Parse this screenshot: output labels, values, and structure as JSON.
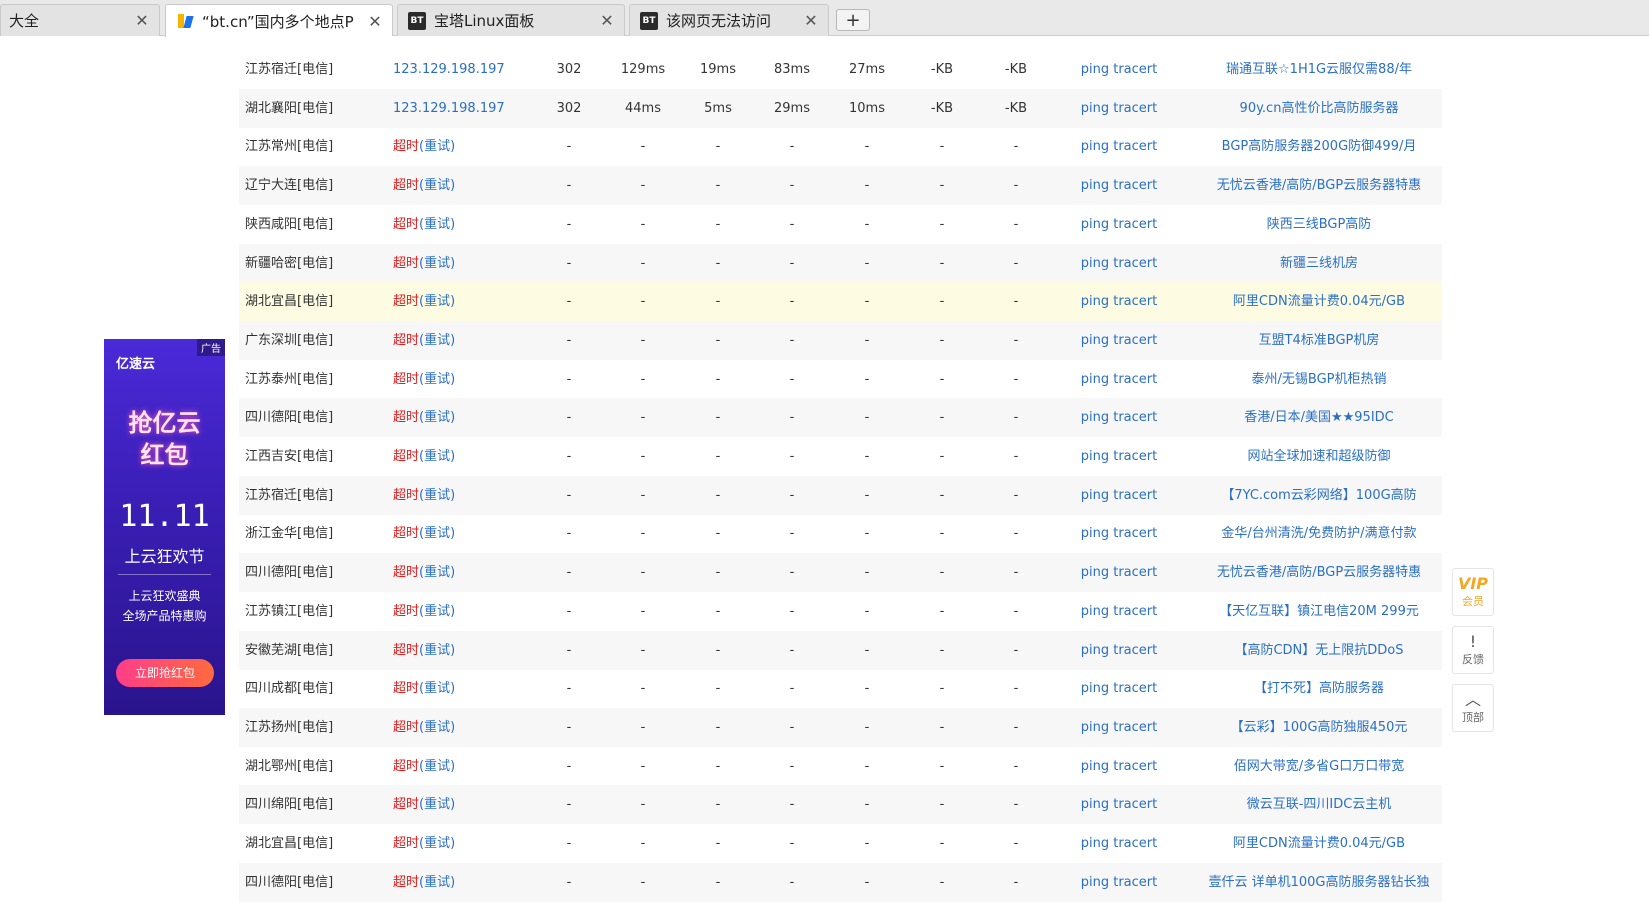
{
  "tabs": [
    {
      "title": "大全",
      "favicon": "none",
      "active": false
    },
    {
      "title": "“bt.cn”国内多个地点P",
      "favicon": "ping-logo",
      "active": true
    },
    {
      "title": "宝塔Linux面板",
      "favicon": "BT",
      "active": false
    },
    {
      "title": "该网页无法访问",
      "favicon": "BT",
      "active": false
    }
  ],
  "newtab_label": "+",
  "close_glyph": "✕",
  "rows": [
    {
      "loc": "江苏宿迁[电信]",
      "ip": "123.129.198.197",
      "status": "302",
      "t1": "129ms",
      "t2": "19ms",
      "t3": "83ms",
      "t4": "27ms",
      "s1": "-KB",
      "s2": "-KB",
      "ping": "ping tracert",
      "ad": "瑞通互联☆1H1G云服仅需88/年"
    },
    {
      "loc": "湖北襄阳[电信]",
      "ip": "123.129.198.197",
      "status": "302",
      "t1": "44ms",
      "t2": "5ms",
      "t3": "29ms",
      "t4": "10ms",
      "s1": "-KB",
      "s2": "-KB",
      "ping": "ping tracert",
      "ad": "90y.cn高性价比高防服务器"
    },
    {
      "loc": "江苏常州[电信]",
      "timeout": "超时",
      "retry": "(重试)",
      "dash": "-",
      "ping": "ping tracert",
      "ad": "BGP高防服务器200G防御499/月"
    },
    {
      "loc": "辽宁大连[电信]",
      "timeout": "超时",
      "retry": "(重试)",
      "dash": "-",
      "ping": "ping tracert",
      "ad": "无忧云香港/高防/BGP云服务器特惠"
    },
    {
      "loc": "陕西咸阳[电信]",
      "timeout": "超时",
      "retry": "(重试)",
      "dash": "-",
      "ping": "ping tracert",
      "ad": "陕西三线BGP高防"
    },
    {
      "loc": "新疆哈密[电信]",
      "timeout": "超时",
      "retry": "(重试)",
      "dash": "-",
      "ping": "ping tracert",
      "ad": "新疆三线机房"
    },
    {
      "loc": "湖北宜昌[电信]",
      "timeout": "超时",
      "retry": "(重试)",
      "dash": "-",
      "ping": "ping tracert",
      "ad": "阿里CDN流量计费0.04元/GB"
    },
    {
      "loc": "广东深圳[电信]",
      "timeout": "超时",
      "retry": "(重试)",
      "dash": "-",
      "ping": "ping tracert",
      "ad": "互盟T4标准BGP机房"
    },
    {
      "loc": "江苏泰州[电信]",
      "timeout": "超时",
      "retry": "(重试)",
      "dash": "-",
      "ping": "ping tracert",
      "ad": "泰州/无锡BGP机柜热销"
    },
    {
      "loc": "四川德阳[电信]",
      "timeout": "超时",
      "retry": "(重试)",
      "dash": "-",
      "ping": "ping tracert",
      "ad": "香港/日本/美国★★95IDC"
    },
    {
      "loc": "江西吉安[电信]",
      "timeout": "超时",
      "retry": "(重试)",
      "dash": "-",
      "ping": "ping tracert",
      "ad": "网站全球加速和超级防御"
    },
    {
      "loc": "江苏宿迁[电信]",
      "timeout": "超时",
      "retry": "(重试)",
      "dash": "-",
      "ping": "ping tracert",
      "ad": "【7YC.com云彩网络】100G高防"
    },
    {
      "loc": "浙江金华[电信]",
      "timeout": "超时",
      "retry": "(重试)",
      "dash": "-",
      "ping": "ping tracert",
      "ad": "金华/台州清洗/免费防护/满意付款"
    },
    {
      "loc": "四川德阳[电信]",
      "timeout": "超时",
      "retry": "(重试)",
      "dash": "-",
      "ping": "ping tracert",
      "ad": "无忧云香港/高防/BGP云服务器特惠"
    },
    {
      "loc": "江苏镇江[电信]",
      "timeout": "超时",
      "retry": "(重试)",
      "dash": "-",
      "ping": "ping tracert",
      "ad": "【天亿互联】镇江电信20M 299元"
    },
    {
      "loc": "安徽芜湖[电信]",
      "timeout": "超时",
      "retry": "(重试)",
      "dash": "-",
      "ping": "ping tracert",
      "ad": "【高防CDN】无上限抗DDoS"
    },
    {
      "loc": "四川成都[电信]",
      "timeout": "超时",
      "retry": "(重试)",
      "dash": "-",
      "ping": "ping tracert",
      "ad": "【打不死】高防服务器"
    },
    {
      "loc": "江苏扬州[电信]",
      "timeout": "超时",
      "retry": "(重试)",
      "dash": "-",
      "ping": "ping tracert",
      "ad": "【云彩】100G高防独服450元"
    },
    {
      "loc": "湖北鄂州[电信]",
      "timeout": "超时",
      "retry": "(重试)",
      "dash": "-",
      "ping": "ping tracert",
      "ad": "佰网大带宽/多省G口万口带宽"
    },
    {
      "loc": "四川绵阳[电信]",
      "timeout": "超时",
      "retry": "(重试)",
      "dash": "-",
      "ping": "ping tracert",
      "ad": "微云互联-四川IDC云主机"
    },
    {
      "loc": "湖北宜昌[电信]",
      "timeout": "超时",
      "retry": "(重试)",
      "dash": "-",
      "ping": "ping tracert",
      "ad": "阿里CDN流量计费0.04元/GB"
    },
    {
      "loc": "四川德阳[电信]",
      "timeout": "超时",
      "retry": "(重试)",
      "dash": "-",
      "ping": "ping tracert",
      "ad": "壹仟云 详单机100G高防服务器钻长独"
    }
  ],
  "ad_banner": {
    "tag": "广告",
    "brand": "亿速云",
    "headline1": "抢亿云",
    "headline2": "红包",
    "date": "11.11",
    "sub": "上云狂欢节",
    "small1": "上云狂欢盛典",
    "small2": "全场产品特惠购",
    "button": "立即抢红包"
  },
  "tools": [
    {
      "icon": "VIP",
      "label": "会员"
    },
    {
      "icon": "!",
      "label": "反馈"
    },
    {
      "icon": "︿",
      "label": "顶部"
    }
  ]
}
